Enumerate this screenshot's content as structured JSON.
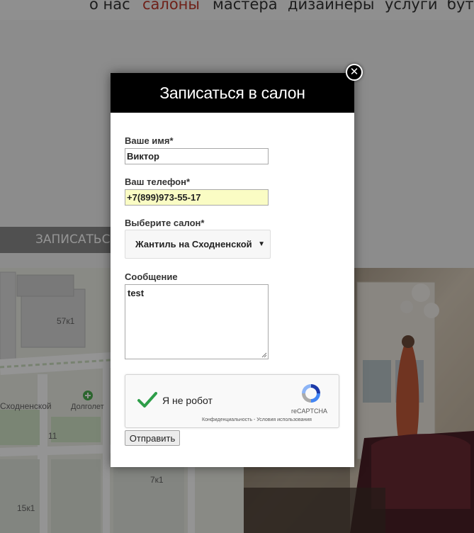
{
  "nav": {
    "items": [
      {
        "label": "о нас"
      },
      {
        "label": "салоны"
      },
      {
        "label": "мастера"
      },
      {
        "label": "дизайнеры"
      },
      {
        "label": "услуги"
      },
      {
        "label": "бути"
      }
    ],
    "active_color": "#c0392b"
  },
  "background": {
    "book_button_label": "ЗАПИСАТЬСЯ",
    "map_labels": [
      "57к1",
      "Сходненской",
      "Долголет",
      "11",
      "7к1",
      "15к1"
    ]
  },
  "modal": {
    "title": "Записаться в салон",
    "close_icon": "close-icon",
    "name_label": "Ваше имя*",
    "name_value": "Виктор",
    "phone_label": "Ваш телефон*",
    "phone_value": "+7(899)973-55-17",
    "salon_label": "Выберите салон*",
    "salon_selected": "Жантиль на Сходненской",
    "message_label": "Сообщение",
    "message_value": "test",
    "captcha": {
      "label": "Я не робот",
      "brand": "reCAPTCHA",
      "terms": "Конфиденциальность - Условия использования",
      "checked": true,
      "check_color": "#2e9e49"
    },
    "submit_label": "Отправить"
  }
}
